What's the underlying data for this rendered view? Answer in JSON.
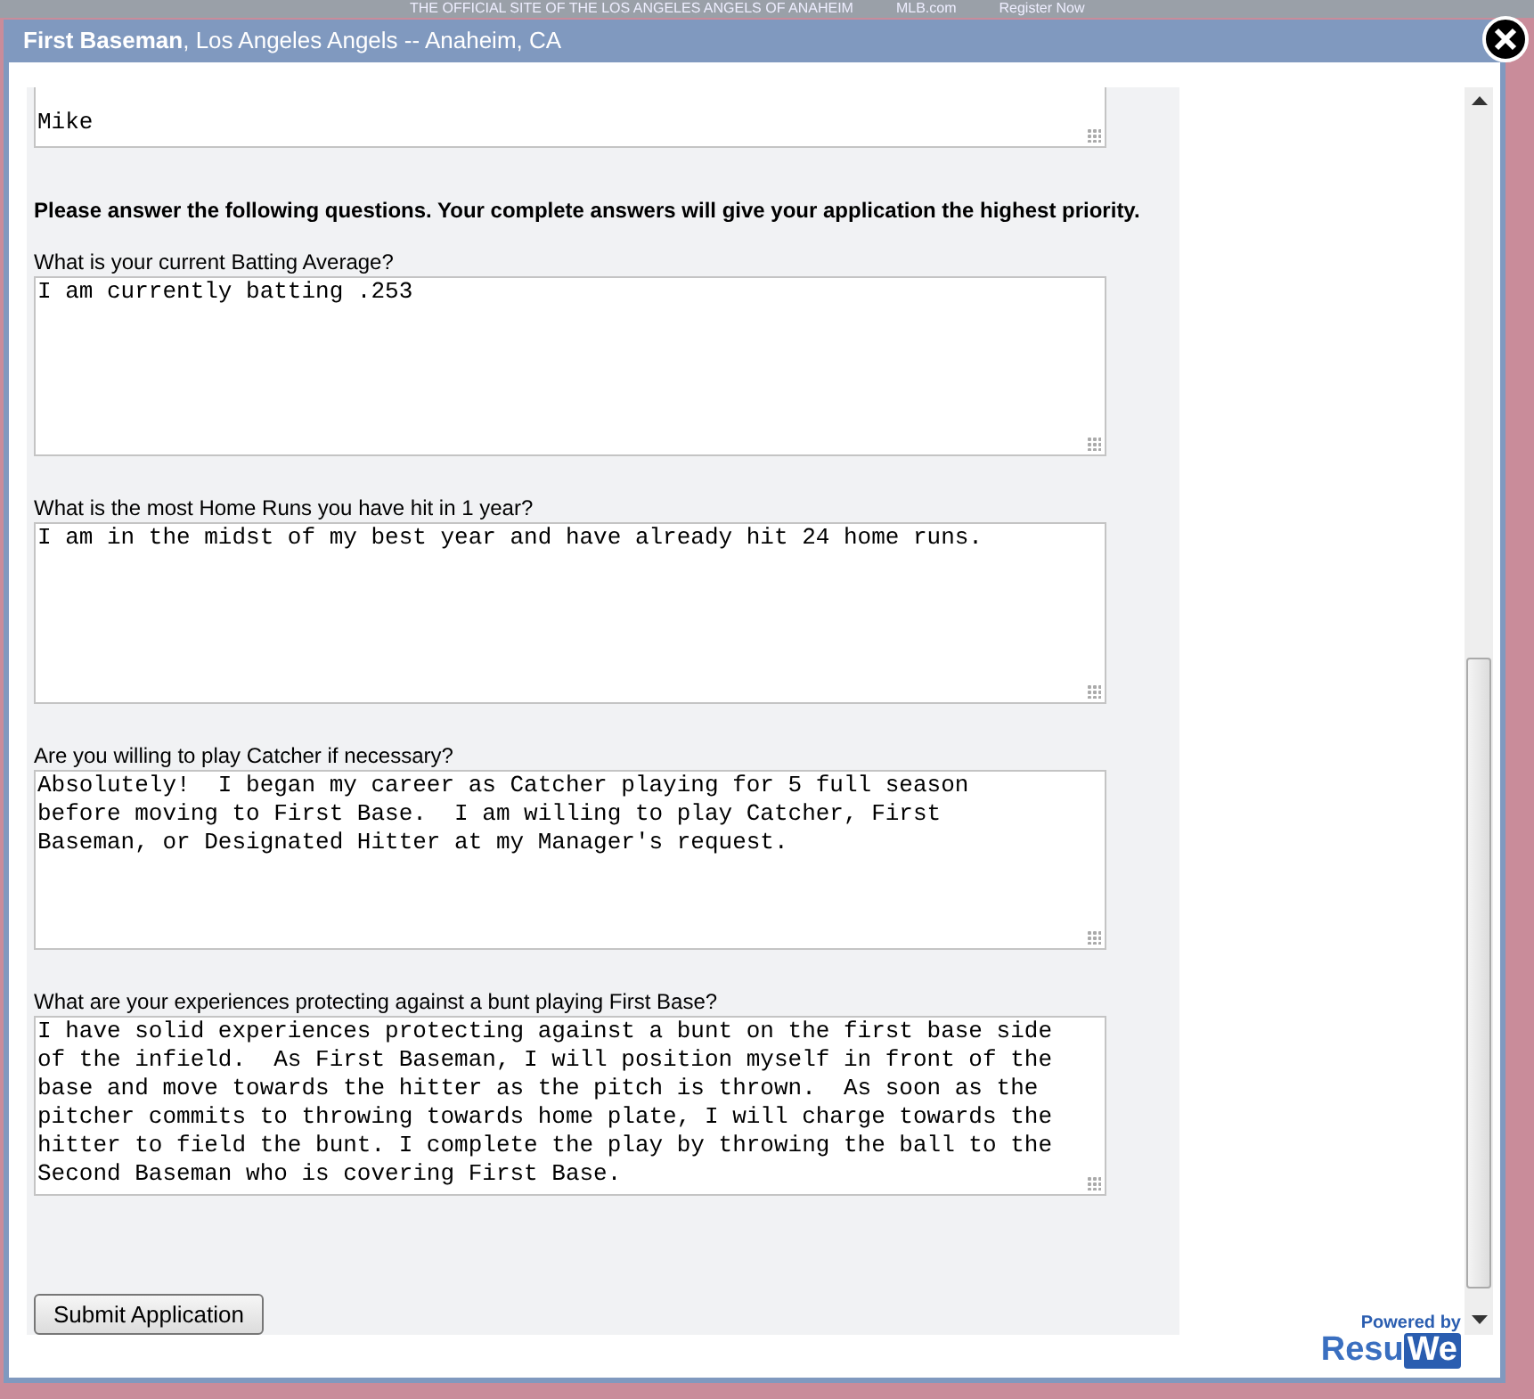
{
  "background_page": {
    "links": [
      "THE OFFICIAL SITE OF THE LOS ANGELES ANGELS OF ANAHEIM",
      "MLB.com",
      "Register Now"
    ]
  },
  "dialog": {
    "title": "**First Baseman**, Los Angeles Angels -- Anaheim, CA"
  },
  "form": {
    "previous_field": {
      "value": "Mike"
    },
    "instructions": "Please answer the following questions. Your complete answers will give your application the highest priority.",
    "questions": [
      {
        "label": "What is your current Batting Average?",
        "value": "I am currently batting .253"
      },
      {
        "label": "What is the most Home Runs you have hit in 1 year?",
        "value": "I am in the midst of my best year and have already hit 24 home runs."
      },
      {
        "label": "Are you willing to play Catcher if necessary?",
        "value": "Absolutely!  I began my career as Catcher playing for 5 full season before moving to First Base.  I am willing to play Catcher, First Baseman, or Designated Hitter at my Manager's request."
      },
      {
        "label": "What are your experiences protecting against a bunt playing First Base?",
        "value": "I have solid experiences protecting against a bunt on the first base side of the infield.  As First Baseman, I will position myself in front of the base and move towards the hitter as the pitch is thrown.  As soon as the pitcher commits to throwing towards home plate, I will charge towards the hitter to field the bunt. I complete the play by throwing the ball to the Second Baseman who is covering First Base."
      }
    ],
    "submit": "Submit Application"
  },
  "footer": {
    "powered_by": "Powered by",
    "logo_left": "Resu",
    "logo_right": "We"
  }
}
